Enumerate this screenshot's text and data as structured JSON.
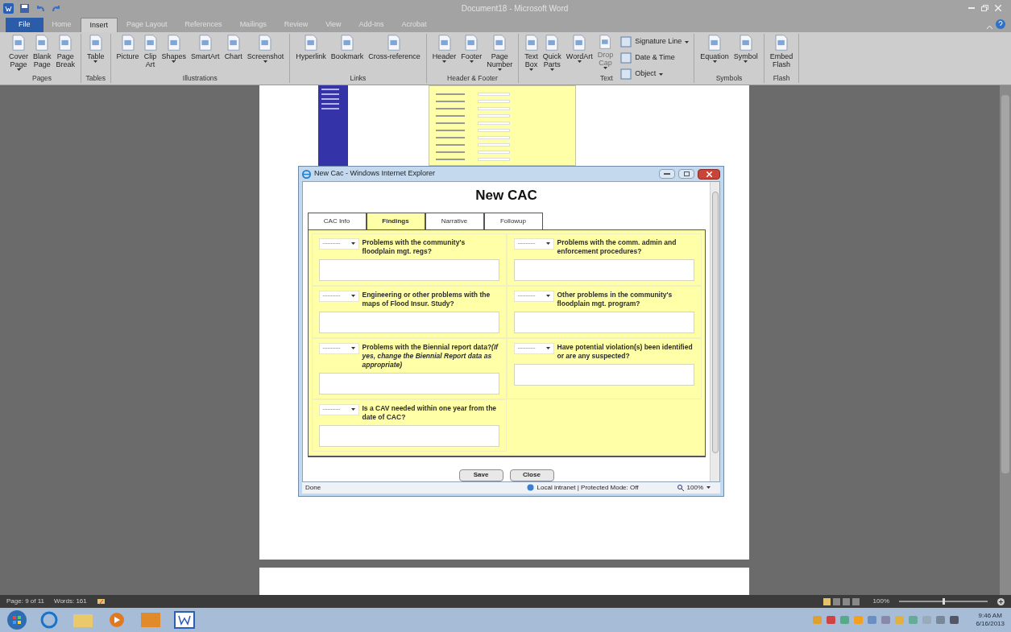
{
  "window": {
    "title": "Document18 - Microsoft Word"
  },
  "ribbon_tabs": [
    {
      "label": "File",
      "selected": false,
      "kind": "file"
    },
    {
      "label": "Home",
      "selected": false,
      "kind": "tab"
    },
    {
      "label": "Insert",
      "selected": true,
      "kind": "tab"
    },
    {
      "label": "Page Layout",
      "selected": false,
      "kind": "tab"
    },
    {
      "label": "References",
      "selected": false,
      "kind": "tab"
    },
    {
      "label": "Mailings",
      "selected": false,
      "kind": "tab"
    },
    {
      "label": "Review",
      "selected": false,
      "kind": "tab"
    },
    {
      "label": "View",
      "selected": false,
      "kind": "tab"
    },
    {
      "label": "Add-Ins",
      "selected": false,
      "kind": "tab"
    },
    {
      "label": "Acrobat",
      "selected": false,
      "kind": "tab"
    }
  ],
  "ribbon_groups": [
    {
      "label": "Pages",
      "items": [
        {
          "kind": "large",
          "lines": [
            "Cover",
            "Page"
          ],
          "dropdown": true,
          "disabled": false
        },
        {
          "kind": "large",
          "lines": [
            "Blank",
            "Page"
          ],
          "dropdown": false,
          "disabled": false
        },
        {
          "kind": "large",
          "lines": [
            "Page",
            "Break"
          ],
          "dropdown": false,
          "disabled": false
        }
      ]
    },
    {
      "label": "Tables",
      "items": [
        {
          "kind": "large",
          "lines": [
            "Table"
          ],
          "dropdown": true,
          "disabled": false
        }
      ]
    },
    {
      "label": "Illustrations",
      "items": [
        {
          "kind": "large",
          "lines": [
            "Picture"
          ],
          "dropdown": false,
          "disabled": false
        },
        {
          "kind": "large",
          "lines": [
            "Clip",
            "Art"
          ],
          "dropdown": false,
          "disabled": false
        },
        {
          "kind": "large",
          "lines": [
            "Shapes"
          ],
          "dropdown": true,
          "disabled": false
        },
        {
          "kind": "large",
          "lines": [
            "SmartArt"
          ],
          "dropdown": false,
          "disabled": false
        },
        {
          "kind": "large",
          "lines": [
            "Chart"
          ],
          "dropdown": false,
          "disabled": false
        },
        {
          "kind": "large",
          "lines": [
            "Screenshot"
          ],
          "dropdown": true,
          "disabled": false
        }
      ]
    },
    {
      "label": "Links",
      "items": [
        {
          "kind": "large",
          "lines": [
            "Hyperlink"
          ],
          "dropdown": false,
          "disabled": false
        },
        {
          "kind": "large",
          "lines": [
            "Bookmark"
          ],
          "dropdown": false,
          "disabled": false
        },
        {
          "kind": "large",
          "lines": [
            "Cross-reference"
          ],
          "dropdown": false,
          "disabled": false
        }
      ]
    },
    {
      "label": "Header & Footer",
      "items": [
        {
          "kind": "large",
          "lines": [
            "Header"
          ],
          "dropdown": true,
          "disabled": false
        },
        {
          "kind": "large",
          "lines": [
            "Footer"
          ],
          "dropdown": true,
          "disabled": false
        },
        {
          "kind": "large",
          "lines": [
            "Page",
            "Number"
          ],
          "dropdown": true,
          "disabled": false
        }
      ]
    },
    {
      "label": "Text",
      "items": [
        {
          "kind": "large",
          "lines": [
            "Text",
            "Box"
          ],
          "dropdown": true,
          "disabled": false
        },
        {
          "kind": "large",
          "lines": [
            "Quick",
            "Parts"
          ],
          "dropdown": true,
          "disabled": false
        },
        {
          "kind": "large",
          "lines": [
            "WordArt"
          ],
          "dropdown": true,
          "disabled": false
        },
        {
          "kind": "large",
          "lines": [
            "Drop",
            "Cap"
          ],
          "dropdown": true,
          "disabled": true
        },
        {
          "kind": "small",
          "lines": [
            "Signature Line"
          ],
          "dropdown": true,
          "disabled": false
        },
        {
          "kind": "small",
          "lines": [
            "Date & Time"
          ],
          "dropdown": false,
          "disabled": false
        },
        {
          "kind": "small",
          "lines": [
            "Object"
          ],
          "dropdown": true,
          "disabled": false
        }
      ]
    },
    {
      "label": "Symbols",
      "items": [
        {
          "kind": "large",
          "lines": [
            "Equation"
          ],
          "dropdown": true,
          "disabled": false
        },
        {
          "kind": "large",
          "lines": [
            "Symbol"
          ],
          "dropdown": true,
          "disabled": false
        }
      ]
    },
    {
      "label": "Flash",
      "items": [
        {
          "kind": "large",
          "lines": [
            "Embed",
            "Flash"
          ],
          "dropdown": false,
          "disabled": false
        }
      ]
    }
  ],
  "ie_window": {
    "title": "New Cac - Windows Internet Explorer",
    "heading": "New CAC",
    "tabs": [
      {
        "label": "CAC Info",
        "selected": false
      },
      {
        "label": "Findings",
        "selected": true
      },
      {
        "label": "Narrative",
        "selected": false
      },
      {
        "label": "Followup",
        "selected": false
      }
    ],
    "questions": [
      {
        "select_value": "-----------",
        "text": "Problems with the community's floodplain mgt. regs?"
      },
      {
        "select_value": "-----------",
        "text": "Problems with the comm. admin and enforcement procedures?"
      },
      {
        "select_value": "-----------",
        "text": "Engineering or other problems with the maps of Flood Insur. Study?"
      },
      {
        "select_value": "-----------",
        "text": "Other problems in the community's floodplain mgt. program?"
      },
      {
        "select_value": "-----------",
        "text": "Problems with the Biennial report data?*(If yes, change the Biennial Report data as appropriate)*"
      },
      {
        "select_value": "-----------",
        "text": "Have potential violation(s) been identified or are any suspected?"
      },
      {
        "select_value": "-----------",
        "text": "Is a CAV needed within one year from the date of CAC?"
      }
    ],
    "buttons": [
      "Save",
      "Close"
    ],
    "status": {
      "left": "Done",
      "zone": "Local intranet | Protected Mode: Off",
      "zoom": "100%"
    }
  },
  "status_bar": {
    "page": "Page: 9 of 11",
    "words": "Words: 161",
    "zoom": "100%",
    "level": 0.5
  },
  "taskbar": {
    "time": "9:46 AM",
    "date": "6/16/2013"
  }
}
